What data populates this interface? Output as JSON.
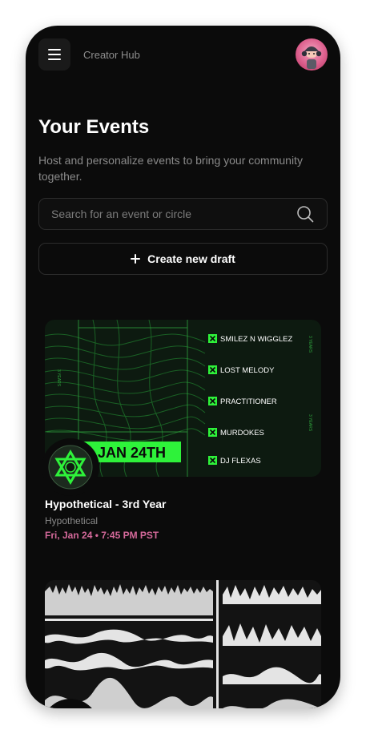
{
  "header": {
    "app_name": "Creator Hub",
    "menu_icon": "hamburger-icon",
    "avatar_icon": "user-avatar"
  },
  "page": {
    "title": "Your Events",
    "subtitle": "Host and personalize events to bring your community together."
  },
  "search": {
    "placeholder": "Search for an event or circle",
    "value": "",
    "icon": "search-icon"
  },
  "create_button": {
    "label": "Create new draft",
    "icon": "plus-icon"
  },
  "events": [
    {
      "title": "Hypothetical - 3rd Year",
      "host": "Hypothetical",
      "date": "Fri, Jan 24 • 7:45 PM PST",
      "poster": {
        "date_text": "JAN 24TH",
        "lineup": [
          "SMILEZ N WIGGLEZ",
          "LOST MELODY",
          "PRACTITIONER",
          "MURDOKES",
          "DJ FLEXAS"
        ],
        "side_text": "3 YEARS"
      }
    },
    {
      "title": "",
      "host": "",
      "date": ""
    }
  ],
  "colors": {
    "background": "#0b0b0b",
    "accent_green": "#2ef23a",
    "date_pink": "#d4699a",
    "muted_text": "#8a8a8a"
  }
}
